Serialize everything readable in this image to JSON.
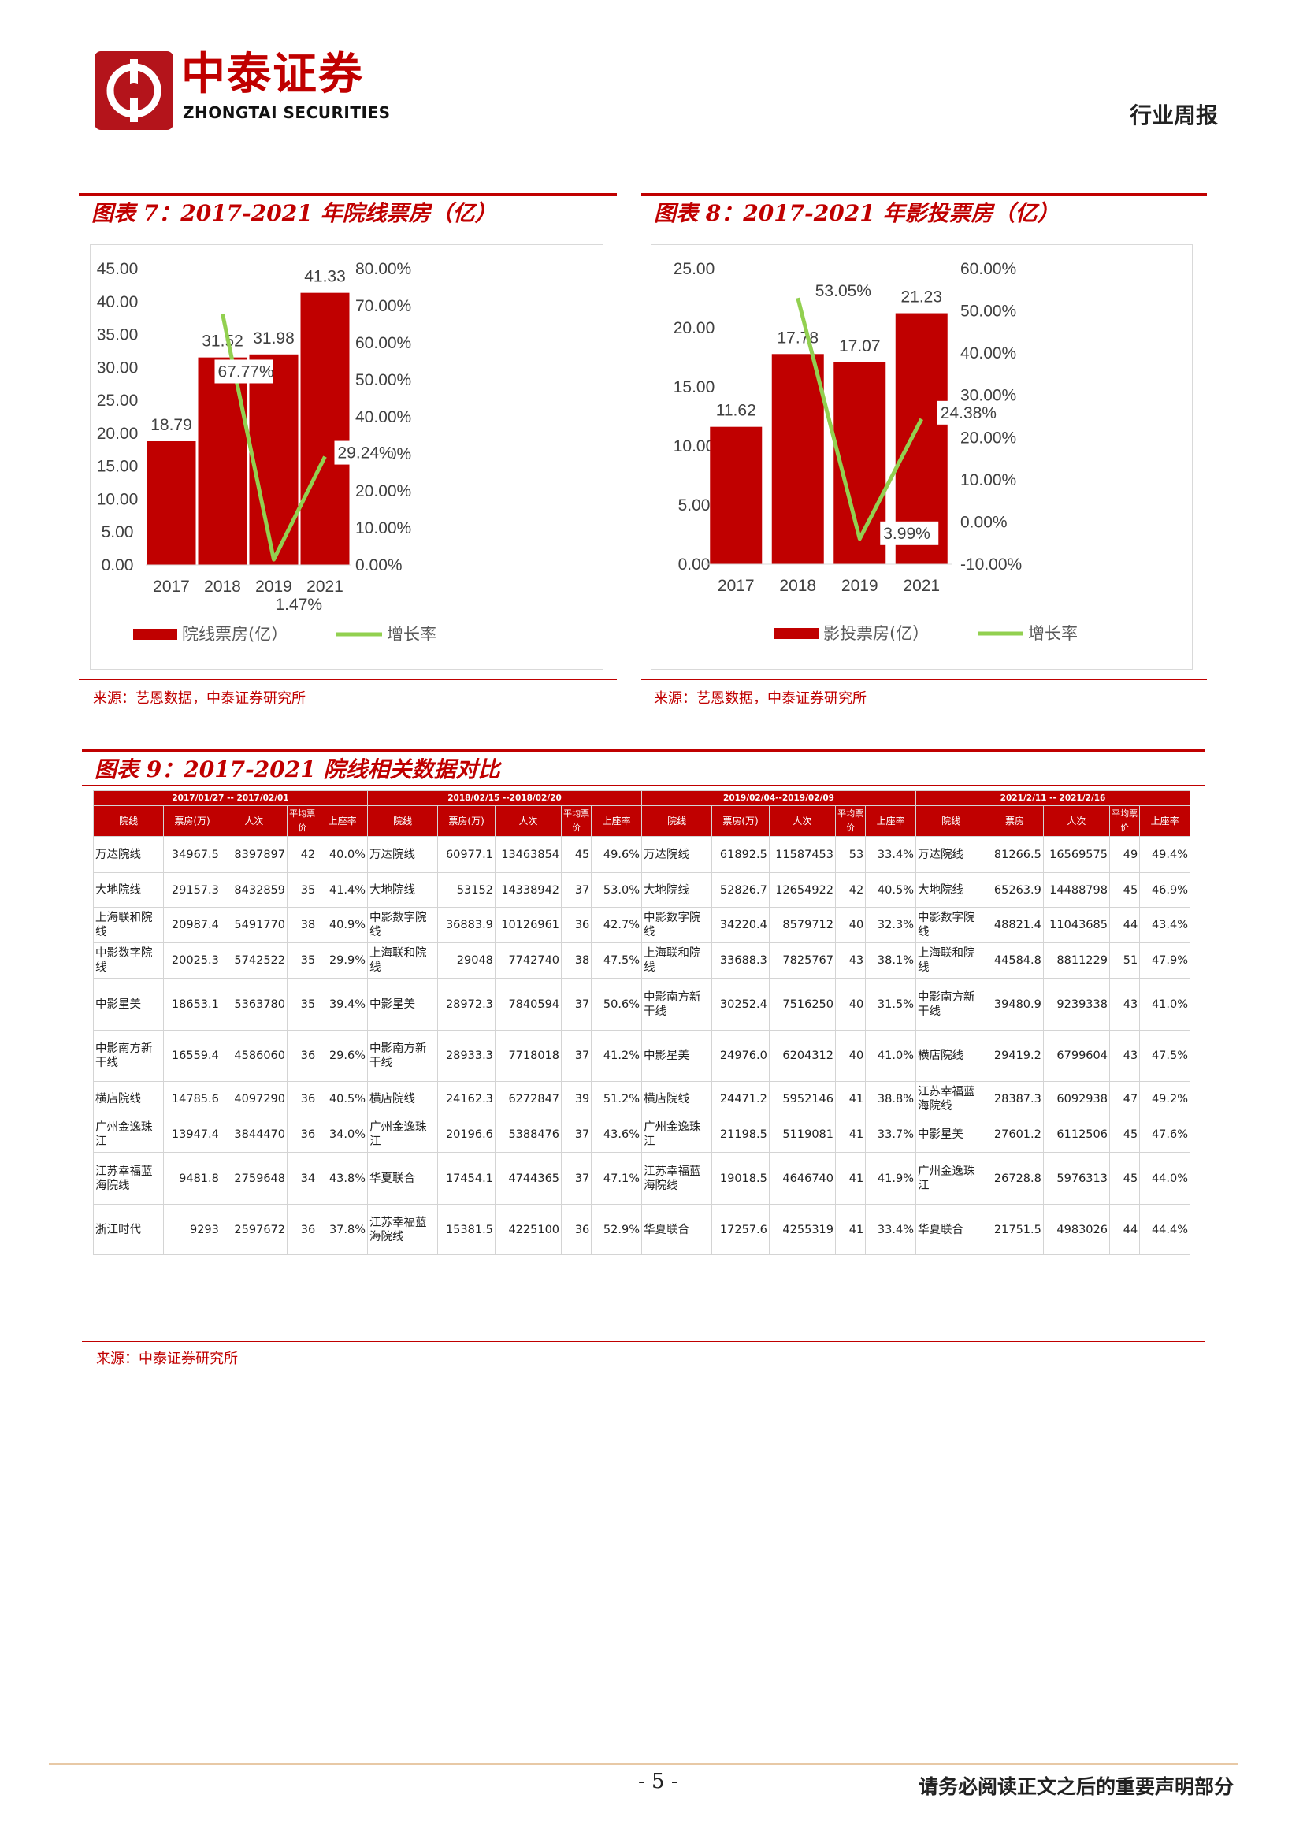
{
  "header": {
    "brand_cn": "中泰证券",
    "brand_en": "ZHONGTAI SECURITIES",
    "report_type": "行业周报"
  },
  "figure7": {
    "title": "图表 7：2017-2021 年院线票房（亿）",
    "source": "来源：艺恩数据，中泰证券研究所"
  },
  "figure8": {
    "title": "图表 8：2017-2021 年影投票房（亿）",
    "source": "来源：艺恩数据，中泰证券研究所"
  },
  "chart_data": [
    {
      "type": "bar",
      "categories": [
        "2017",
        "2018",
        "2019",
        "2021"
      ],
      "series": [
        {
          "name": "院线票房(亿）",
          "type": "bar",
          "values": [
            18.79,
            31.52,
            31.98,
            41.33
          ],
          "axis": "left",
          "color": "#c00000"
        },
        {
          "name": "增长率",
          "type": "line",
          "values": [
            null,
            67.77,
            1.47,
            29.24
          ],
          "axis": "right",
          "unit": "%",
          "color": "#92d050"
        }
      ],
      "left_ticks": [
        "45.00",
        "40.00",
        "35.00",
        "30.00",
        "25.00",
        "20.00",
        "15.00",
        "10.00",
        "5.00",
        "0.00"
      ],
      "right_ticks": [
        "80.00%",
        "70.00%",
        "60.00%",
        "50.00%",
        "40.00%",
        "30.00%",
        "20.00%",
        "10.00%",
        "0.00%"
      ],
      "bar_labels": [
        "18.79",
        "31.52",
        "31.98",
        "41.33"
      ],
      "line_labels": [
        "67.77%",
        "1.47%",
        "29.24%"
      ],
      "ylim_left": [
        0,
        45
      ],
      "ylim_right": [
        0,
        80
      ],
      "grid": false,
      "legend": "bottom"
    },
    {
      "type": "bar",
      "categories": [
        "2017",
        "2018",
        "2019",
        "2021"
      ],
      "series": [
        {
          "name": "影投票房(亿）",
          "type": "bar",
          "values": [
            11.62,
            17.78,
            17.07,
            21.23
          ],
          "axis": "left",
          "color": "#c00000"
        },
        {
          "name": "增长率",
          "type": "line",
          "values": [
            null,
            53.05,
            -3.99,
            24.38
          ],
          "axis": "right",
          "unit": "%",
          "color": "#92d050"
        }
      ],
      "left_ticks": [
        "25.00",
        "20.00",
        "15.00",
        "10.00",
        "5.00",
        "0.00"
      ],
      "right_ticks": [
        "60.00%",
        "50.00%",
        "40.00%",
        "30.00%",
        "20.00%",
        "10.00%",
        "0.00%",
        "-10.00%"
      ],
      "bar_labels": [
        "11.62",
        "17.78",
        "17.07",
        "21.23"
      ],
      "line_labels": [
        "53.05%",
        "3.99%",
        "24.38%"
      ],
      "ylim_left": [
        0,
        25
      ],
      "ylim_right": [
        -10,
        60
      ],
      "grid": false,
      "legend": "bottom"
    }
  ],
  "figure9": {
    "title": "图表 9：2017-2021 院线相关数据对比",
    "source": "来源：中泰证券研究所",
    "periods": [
      "2017/01/27 -- 2017/02/01",
      "2018/02/15 --2018/02/20",
      "2019/02/04--2019/02/09",
      "2021/2/11 -- 2021/2/16"
    ],
    "headers": [
      [
        "院线",
        "票房(万)",
        "人次",
        "平均票价",
        "上座率"
      ],
      [
        "院线",
        "票房(万)",
        "人次",
        "平均票价",
        "上座率"
      ],
      [
        "院线",
        "票房(万)",
        "人次",
        "平均票价",
        "上座率"
      ],
      [
        "院线",
        "票房",
        "人次",
        "平均票价",
        "上座率"
      ]
    ],
    "rows": [
      [
        "万达院线",
        "34967.5",
        "8397897",
        "42",
        "40.0%",
        "万达院线",
        "60977.1",
        "13463854",
        "45",
        "49.6%",
        "万达院线",
        "61892.5",
        "11587453",
        "53",
        "33.4%",
        "万达院线",
        "81266.5",
        "16569575",
        "49",
        "49.4%"
      ],
      [
        "大地院线",
        "29157.3",
        "8432859",
        "35",
        "41.4%",
        "大地院线",
        "53152",
        "14338942",
        "37",
        "53.0%",
        "大地院线",
        "52826.7",
        "12654922",
        "42",
        "40.5%",
        "大地院线",
        "65263.9",
        "14488798",
        "45",
        "46.9%"
      ],
      [
        "上海联和院线",
        "20987.4",
        "5491770",
        "38",
        "40.9%",
        "中影数字院线",
        "36883.9",
        "10126961",
        "36",
        "42.7%",
        "中影数字院线",
        "34220.4",
        "8579712",
        "40",
        "32.3%",
        "中影数字院线",
        "48821.4",
        "11043685",
        "44",
        "43.4%"
      ],
      [
        "中影数字院线",
        "20025.3",
        "5742522",
        "35",
        "29.9%",
        "上海联和院线",
        "29048",
        "7742740",
        "38",
        "47.5%",
        "上海联和院线",
        "33688.3",
        "7825767",
        "43",
        "38.1%",
        "上海联和院线",
        "44584.8",
        "8811229",
        "51",
        "47.9%"
      ],
      [
        "中影星美",
        "18653.1",
        "5363780",
        "35",
        "39.4%",
        "中影星美",
        "28972.3",
        "7840594",
        "37",
        "50.6%",
        "中影南方新干线",
        "30252.4",
        "7516250",
        "40",
        "31.5%",
        "中影南方新干线",
        "39480.9",
        "9239338",
        "43",
        "41.0%"
      ],
      [
        "中影南方新干线",
        "16559.4",
        "4586060",
        "36",
        "29.6%",
        "中影南方新干线",
        "28933.3",
        "7718018",
        "37",
        "41.2%",
        "中影星美",
        "24976.0",
        "6204312",
        "40",
        "41.0%",
        "横店院线",
        "29419.2",
        "6799604",
        "43",
        "47.5%"
      ],
      [
        "横店院线",
        "14785.6",
        "4097290",
        "36",
        "40.5%",
        "横店院线",
        "24162.3",
        "6272847",
        "39",
        "51.2%",
        "横店院线",
        "24471.2",
        "5952146",
        "41",
        "38.8%",
        "江苏幸福蓝海院线",
        "28387.3",
        "6092938",
        "47",
        "49.2%"
      ],
      [
        "广州金逸珠江",
        "13947.4",
        "3844470",
        "36",
        "34.0%",
        "广州金逸珠江",
        "20196.6",
        "5388476",
        "37",
        "43.6%",
        "广州金逸珠江",
        "21198.5",
        "5119081",
        "41",
        "33.7%",
        "中影星美",
        "27601.2",
        "6112506",
        "45",
        "47.6%"
      ],
      [
        "江苏幸福蓝海院线",
        "9481.8",
        "2759648",
        "34",
        "43.8%",
        "华夏联合",
        "17454.1",
        "4744365",
        "37",
        "47.1%",
        "江苏幸福蓝海院线",
        "19018.5",
        "4646740",
        "41",
        "41.9%",
        "广州金逸珠江",
        "26728.8",
        "5976313",
        "45",
        "44.0%"
      ],
      [
        "浙江时代",
        "9293",
        "2597672",
        "36",
        "37.8%",
        "江苏幸福蓝海院线",
        "15381.5",
        "4225100",
        "36",
        "52.9%",
        "华夏联合",
        "17257.6",
        "4255319",
        "41",
        "33.4%",
        "华夏联合",
        "21751.5",
        "4983026",
        "44",
        "44.4%"
      ]
    ]
  },
  "footer": {
    "page_number": "- 5 -",
    "disclaimer": "请务必阅读正文之后的重要声明部分"
  }
}
